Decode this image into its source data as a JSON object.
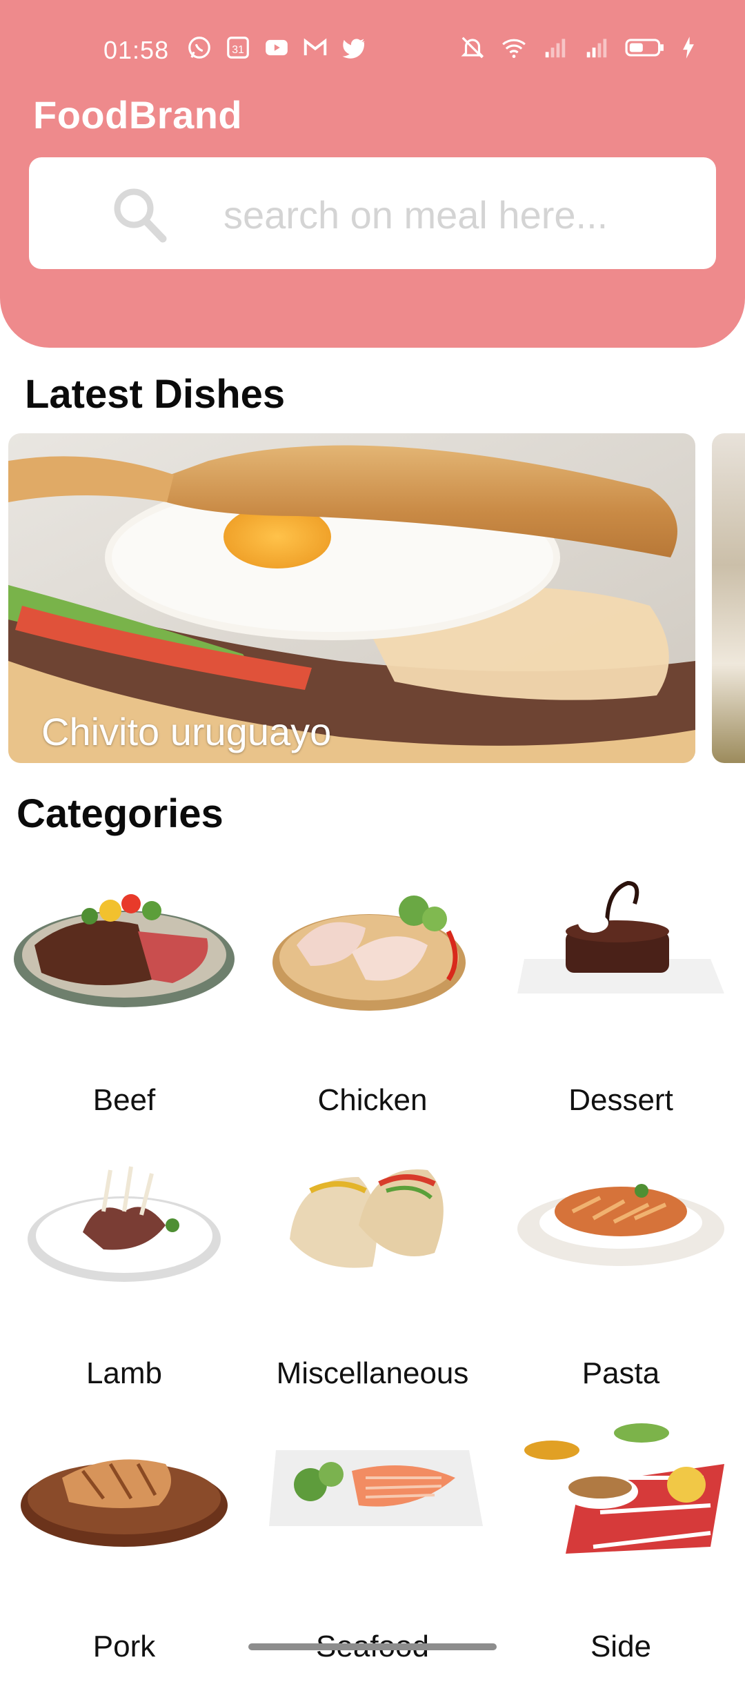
{
  "status_bar": {
    "time": "01:58",
    "calendar_date": "31",
    "left_icons": [
      "whatsapp-icon",
      "calendar-icon",
      "youtube-icon",
      "gmail-icon",
      "twitter-icon"
    ],
    "right_icons": [
      "mute-icon",
      "wifi-icon",
      "signal-icon",
      "signal-icon",
      "battery-icon",
      "charging-icon"
    ]
  },
  "app": {
    "brand": "FoodBrand",
    "accent_color": "#ee8a8c"
  },
  "search": {
    "placeholder": "search on meal here...",
    "value": ""
  },
  "latest": {
    "title": "Latest Dishes",
    "dishes": [
      {
        "name": "Chivito uruguayo"
      }
    ]
  },
  "categories": {
    "title": "Categories",
    "items": [
      {
        "label": "Beef",
        "icon": "beef-image"
      },
      {
        "label": "Chicken",
        "icon": "chicken-image"
      },
      {
        "label": "Dessert",
        "icon": "dessert-image"
      },
      {
        "label": "Lamb",
        "icon": "lamb-image"
      },
      {
        "label": "Miscellaneous",
        "icon": "tacos-image"
      },
      {
        "label": "Pasta",
        "icon": "pasta-image"
      },
      {
        "label": "Pork",
        "icon": "pork-image"
      },
      {
        "label": "Seafood",
        "icon": "seafood-image"
      },
      {
        "label": "Side",
        "icon": "side-dish-image"
      }
    ]
  }
}
